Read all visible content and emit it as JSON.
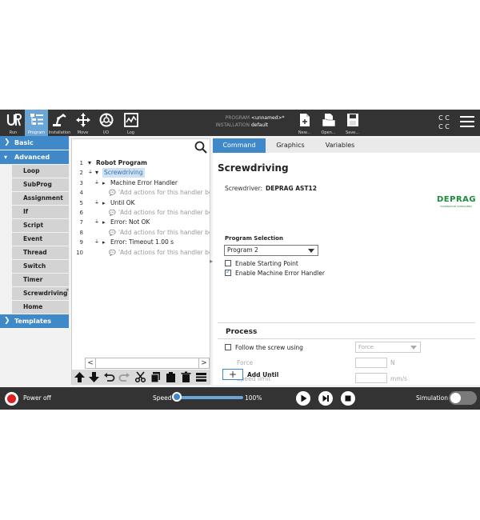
{
  "topbar": {
    "tabs": [
      {
        "label": "Run",
        "icon": "ur-logo-icon"
      },
      {
        "label": "Program",
        "icon": "program-icon"
      },
      {
        "label": "Installation",
        "icon": "installation-icon"
      },
      {
        "label": "Move",
        "icon": "move-icon"
      },
      {
        "label": "I/O",
        "icon": "io-icon"
      },
      {
        "label": "Log",
        "icon": "log-icon"
      }
    ],
    "active_tab": "Program",
    "program_key": "PROGRAM",
    "program_value": "<unnamed>*",
    "installation_key": "INSTALLATION",
    "installation_value": "default",
    "file_buttons": [
      {
        "label": "New...",
        "icon": "new-file-icon"
      },
      {
        "label": "Open...",
        "icon": "open-folder-icon"
      },
      {
        "label": "Save...",
        "icon": "save-icon"
      }
    ],
    "lang_icon": "language-icon",
    "lang_lines": [
      "C C",
      "C C"
    ],
    "menu_icon": "hamburger-menu-icon"
  },
  "leftnav": {
    "basic_label": "Basic",
    "advanced_label": "Advanced",
    "advanced_items": [
      "Loop",
      "SubProg",
      "Assignment",
      "If",
      "Script",
      "Event",
      "Thread",
      "Switch",
      "Timer",
      "Screwdriving",
      "Home"
    ],
    "templates_label": "Templates"
  },
  "tree": {
    "lines": [
      {
        "n": "1",
        "text": "Robot Program"
      },
      {
        "n": "2",
        "text": "Screwdriving"
      },
      {
        "n": "3",
        "text": "Machine Error Handler"
      },
      {
        "n": "4",
        "text": "'Add actions for this handler be"
      },
      {
        "n": "5",
        "text": "Until OK"
      },
      {
        "n": "6",
        "text": "'Add actions for this handler be"
      },
      {
        "n": "7",
        "text": "Error: Not OK"
      },
      {
        "n": "8",
        "text": "'Add actions for this handler be"
      },
      {
        "n": "9",
        "text": "Error: Timeout 1.00 s"
      },
      {
        "n": "10",
        "text": "'Add actions for this handler be"
      }
    ],
    "hscroll_left": "<",
    "hscroll_right": ">",
    "collapse_arrow": "◂",
    "toolbar_icons": [
      "move-up-icon",
      "move-down-icon",
      "undo-icon",
      "redo-icon",
      "cut-icon",
      "copy-icon",
      "paste-icon",
      "delete-icon",
      "suppress-icon"
    ]
  },
  "rightpanel": {
    "tabs": [
      "Command",
      "Graphics",
      "Variables"
    ],
    "active_tab": "Command",
    "title": "Screwdriving",
    "screwdriver_label": "Screwdriver:",
    "screwdriver_value": "DEPRAG AST12",
    "logo_text": "DEPRAG",
    "logo_tagline": "FASZINATION SCHRAUBEN",
    "program_selection_label": "Program Selection",
    "program_selected": "Program 2",
    "enable_starting_point": {
      "label": "Enable Starting Point",
      "checked": false
    },
    "enable_error_handler": {
      "label": "Enable Machine Error Handler",
      "checked": true
    },
    "process_title": "Process",
    "follow_label": "Follow the screw using",
    "follow_checked": false,
    "method_selected": "Force",
    "force_label": "Force",
    "force_unit": "N",
    "speed_limit_label": "Speed limit",
    "speed_limit_unit": "mm/s",
    "add_until_symbol": "+",
    "add_until_label": "Add Until"
  },
  "bottombar": {
    "power_label": "Power off",
    "speed_label": "Speed",
    "speed_value": "100%",
    "speed_fraction": 1.0,
    "simulation_label": "Simulation",
    "simulation_on": false
  },
  "colors": {
    "accent": "#3f89c8",
    "dark_bar": "#333333",
    "power_red": "#e02020",
    "deprag_green": "#1a8c3c"
  }
}
